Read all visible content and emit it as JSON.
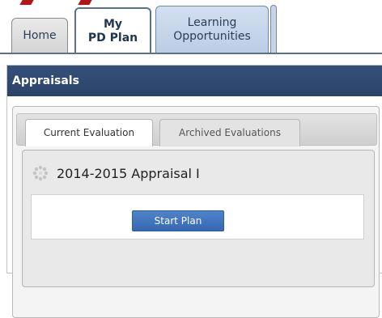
{
  "topnav": {
    "tabs": [
      {
        "lines": [
          "Home"
        ]
      },
      {
        "lines": [
          "My",
          "PD Plan"
        ]
      },
      {
        "lines": [
          "Learning",
          "Opportunities"
        ]
      }
    ]
  },
  "panel": {
    "title": "Appraisals",
    "subtabs": [
      "Current Evaluation",
      "Archived Evaluations"
    ],
    "evaluation": {
      "title": "2014-2015 Appraisal I",
      "button_label": "Start Plan"
    }
  },
  "colors": {
    "header_bg": "#2e4a72",
    "button_bg": "#3f74bd",
    "nav_accent": "#b01818"
  },
  "icons": {
    "evaluation_status": "spinner-icon"
  }
}
